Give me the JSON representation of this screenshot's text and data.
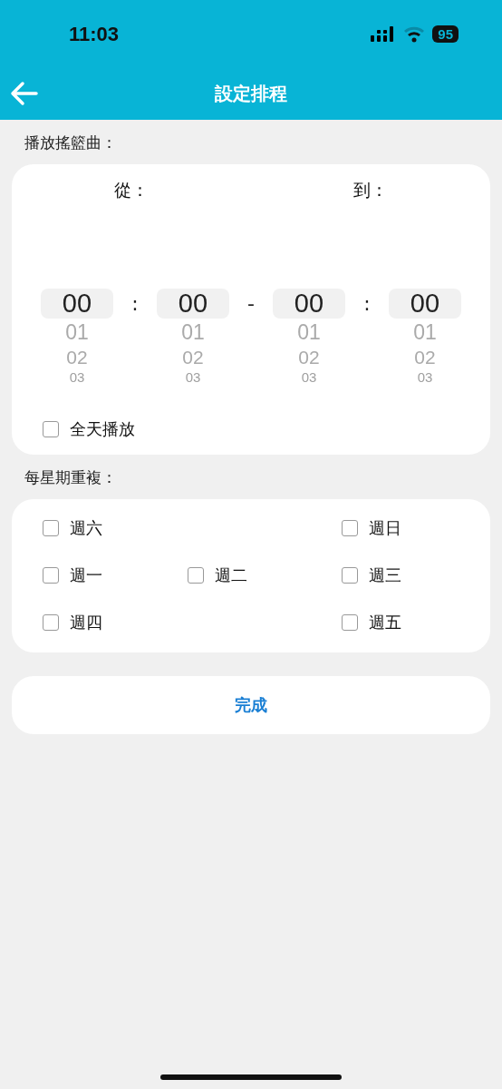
{
  "status_bar": {
    "time": "11:03",
    "battery": "95"
  },
  "header": {
    "title": "設定排程"
  },
  "play_section": {
    "label": "播放搖籃曲：",
    "from_label": "從：",
    "to_label": "到：",
    "pickers": [
      {
        "kind": "wheel",
        "items": [
          {
            "value": "00",
            "selected": true
          },
          {
            "value": "01",
            "selected": false
          },
          {
            "value": "02",
            "selected": false
          },
          {
            "value": "03",
            "selected": false
          }
        ]
      },
      {
        "kind": "separator",
        "text": ":"
      },
      {
        "kind": "wheel",
        "items": [
          {
            "value": "00",
            "selected": true
          },
          {
            "value": "01",
            "selected": false
          },
          {
            "value": "02",
            "selected": false
          },
          {
            "value": "03",
            "selected": false
          }
        ]
      },
      {
        "kind": "separator",
        "text": "-"
      },
      {
        "kind": "wheel",
        "items": [
          {
            "value": "00",
            "selected": true
          },
          {
            "value": "01",
            "selected": false
          },
          {
            "value": "02",
            "selected": false
          },
          {
            "value": "03",
            "selected": false
          }
        ]
      },
      {
        "kind": "separator",
        "text": ":"
      },
      {
        "kind": "wheel",
        "items": [
          {
            "value": "00",
            "selected": true
          },
          {
            "value": "01",
            "selected": false
          },
          {
            "value": "02",
            "selected": false
          },
          {
            "value": "03",
            "selected": false
          }
        ]
      }
    ],
    "all_day": {
      "label": "全天播放",
      "checked": false
    }
  },
  "repeat_section": {
    "label": "每星期重複：",
    "rows": [
      [
        {
          "label": "週六",
          "checked": false
        },
        null,
        {
          "label": "週日",
          "checked": false
        }
      ],
      [
        {
          "label": "週一",
          "checked": false
        },
        {
          "label": "週二",
          "checked": false
        },
        {
          "label": "週三",
          "checked": false
        }
      ],
      [
        {
          "label": "週四",
          "checked": false
        },
        null,
        {
          "label": "週五",
          "checked": false
        }
      ]
    ]
  },
  "done_button": "完成"
}
